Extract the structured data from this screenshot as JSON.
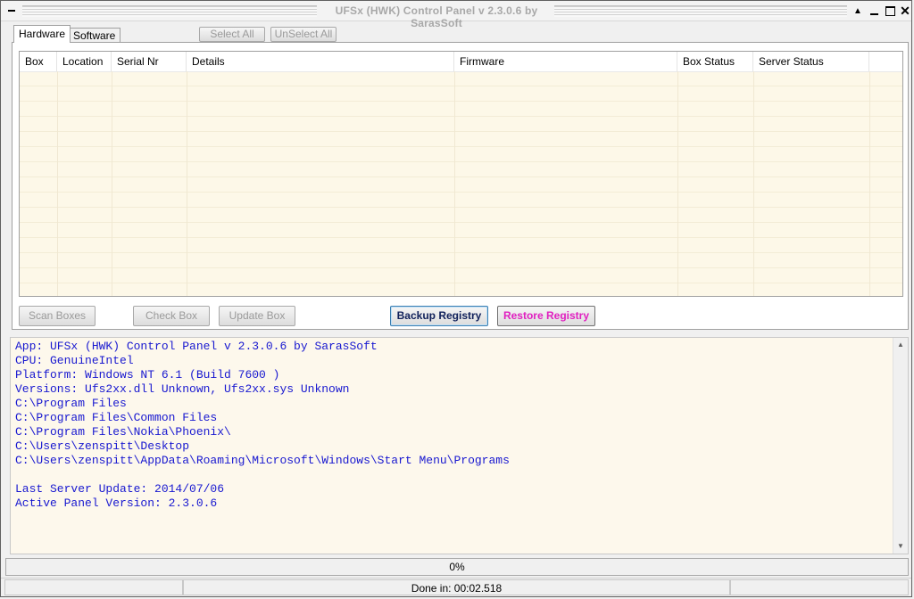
{
  "window": {
    "title": "UFSx (HWK) Control Panel v 2.3.0.6 by SarasSoft",
    "close_glyph": "✕"
  },
  "tabs": [
    {
      "label": "Hardware",
      "active": true
    },
    {
      "label": "Software",
      "active": false
    }
  ],
  "selection": {
    "select_all_label": "Select All",
    "unselect_all_label": "UnSelect All"
  },
  "grid": {
    "columns": [
      "Box",
      "Location",
      "Serial Nr",
      "Details",
      "Firmware",
      "Box Status",
      "Server Status"
    ],
    "rows": []
  },
  "actions": {
    "scan_boxes": "Scan Boxes",
    "check_box": "Check Box",
    "update_box": "Update Box",
    "backup_registry": "Backup Registry",
    "restore_registry": "Restore Registry"
  },
  "log": {
    "lines": [
      "App: UFSx (HWK) Control Panel v 2.3.0.6 by SarasSoft",
      "CPU: GenuineIntel",
      "Platform: Windows NT 6.1 (Build 7600 )",
      "Versions: Ufs2xx.dll Unknown, Ufs2xx.sys Unknown",
      "C:\\Program Files",
      "C:\\Program Files\\Common Files",
      "C:\\Program Files\\Nokia\\Phoenix\\",
      "C:\\Users\\zenspitt\\Desktop",
      "C:\\Users\\zenspitt\\AppData\\Roaming\\Microsoft\\Windows\\Start Menu\\Programs",
      "",
      "Last Server Update: 2014/07/06",
      "Active Panel Version: 2.3.0.6"
    ],
    "text_color": "#1818d0",
    "background_color": "#fdf8ec"
  },
  "progress": {
    "label": "0%",
    "value": 0
  },
  "status": {
    "cell1": "",
    "done_label": "Done in: 00:02.518",
    "cell3": ""
  },
  "colors": {
    "restore_registry_text": "#e020c0",
    "backup_registry_text": "#10205a",
    "grid_background": "#fdf8e8"
  }
}
